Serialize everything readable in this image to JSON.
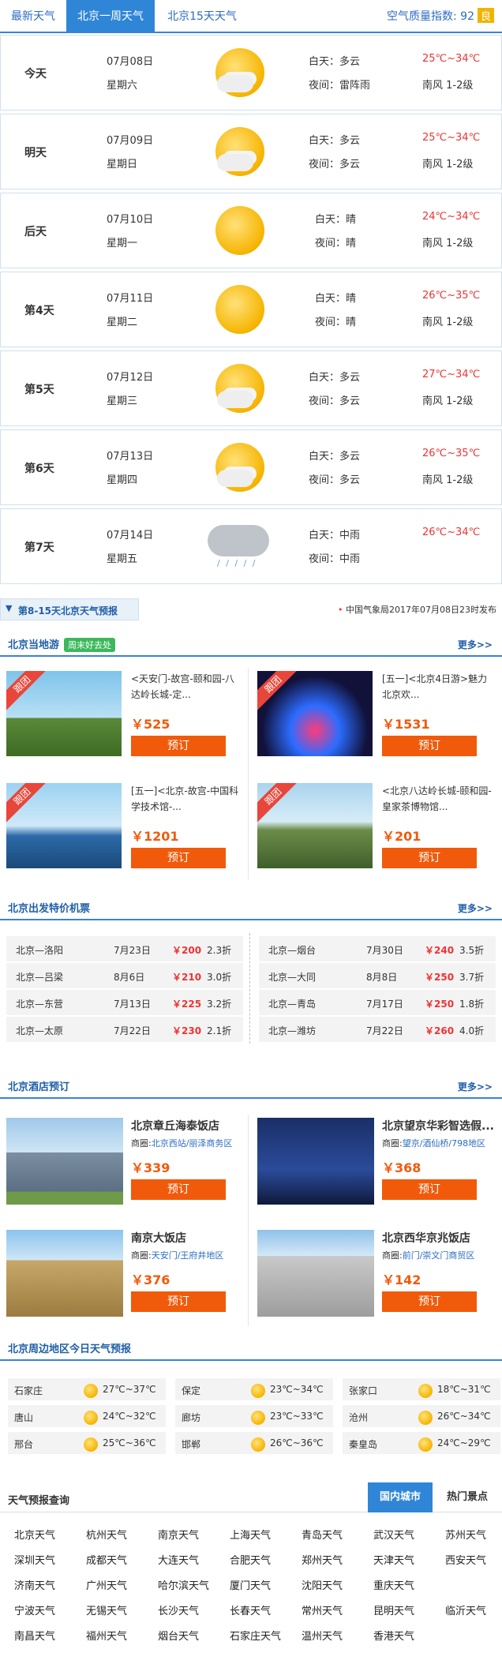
{
  "tabs": {
    "latest": "最新天气",
    "week": "北京一周天气",
    "fifteen": "北京15天天气"
  },
  "aqi": {
    "label": "空气质量指数:",
    "value": "92",
    "level": "良"
  },
  "forecast": [
    {
      "label": "今天",
      "date": "07月08日",
      "weekday": "星期六",
      "icon": "sun-cloud-icon",
      "day": "白天：多云",
      "night": "夜间：雷阵雨",
      "temp": "25℃~34℃",
      "wind": "南风 1-2级"
    },
    {
      "label": "明天",
      "date": "07月09日",
      "weekday": "星期日",
      "icon": "sun-cloud-icon",
      "day": "白天：多云",
      "night": "夜间：多云",
      "temp": "25℃~34℃",
      "wind": "南风 1-2级"
    },
    {
      "label": "后天",
      "date": "07月10日",
      "weekday": "星期一",
      "icon": "sun-icon",
      "day": "白天：晴",
      "night": "夜间：晴",
      "temp": "24℃~34℃",
      "wind": "南风 1-2级"
    },
    {
      "label": "第4天",
      "date": "07月11日",
      "weekday": "星期二",
      "icon": "sun-icon",
      "day": "白天：晴",
      "night": "夜间：晴",
      "temp": "26℃~35℃",
      "wind": "南风 1-2级"
    },
    {
      "label": "第5天",
      "date": "07月12日",
      "weekday": "星期三",
      "icon": "sun-cloud-icon",
      "day": "白天：多云",
      "night": "夜间：多云",
      "temp": "27℃~34℃",
      "wind": "南风 1-2级"
    },
    {
      "label": "第6天",
      "date": "07月13日",
      "weekday": "星期四",
      "icon": "sun-cloud-icon",
      "day": "白天：多云",
      "night": "夜间：多云",
      "temp": "26℃~35℃",
      "wind": "南风 1-2级"
    },
    {
      "label": "第7天",
      "date": "07月14日",
      "weekday": "星期五",
      "icon": "rain-cloud-icon",
      "day": "白天：中雨",
      "night": "夜间：中雨",
      "temp": "26℃~34℃",
      "wind": ""
    }
  ],
  "more15": {
    "label": "第8-15天北京天气预报",
    "source": "中国气象局2017年07月08日23时发布"
  },
  "tour": {
    "title": "北京当地游",
    "tag": "周末好去处",
    "more": "更多>>",
    "ribbon": "跟团",
    "book": "预订",
    "items": [
      {
        "desc": "<天安门-故宫-颐和园-八达岭长城-定...",
        "price": "￥525"
      },
      {
        "desc": "[五一]<北京4日游>魅力北京欢...",
        "price": "￥1531"
      },
      {
        "desc": "[五一]<北京-故宫-中国科学技术馆-...",
        "price": "￥1201"
      },
      {
        "desc": "<北京八达岭长城-颐和园-皇家茶博物馆...",
        "price": "￥201"
      }
    ]
  },
  "flights": {
    "title": "北京出发特价机票",
    "more": "更多>>",
    "left": [
      {
        "route": "北京—洛阳",
        "date": "7月23日",
        "price": "￥200",
        "disc": "2.3折"
      },
      {
        "route": "北京—吕梁",
        "date": "8月6日",
        "price": "￥210",
        "disc": "3.0折"
      },
      {
        "route": "北京—东营",
        "date": "7月13日",
        "price": "￥225",
        "disc": "3.2折"
      },
      {
        "route": "北京—太原",
        "date": "7月22日",
        "price": "￥230",
        "disc": "2.1折"
      }
    ],
    "right": [
      {
        "route": "北京—烟台",
        "date": "7月30日",
        "price": "￥240",
        "disc": "3.5折"
      },
      {
        "route": "北京—大同",
        "date": "8月8日",
        "price": "￥250",
        "disc": "3.7折"
      },
      {
        "route": "北京—青岛",
        "date": "7月17日",
        "price": "￥250",
        "disc": "1.8折"
      },
      {
        "route": "北京—潍坊",
        "date": "7月22日",
        "price": "￥260",
        "disc": "4.0折"
      }
    ]
  },
  "hotels": {
    "title": "北京酒店预订",
    "more": "更多>>",
    "book": "预订",
    "area_label": "商圈:",
    "items": [
      {
        "name": "北京章丘海泰饭店",
        "area": "北京西站/丽泽商务区",
        "price": "￥339"
      },
      {
        "name": "北京望京华彩智选假...",
        "area": "望京/酒仙桥/798地区",
        "price": "￥368"
      },
      {
        "name": "南京大饭店",
        "area": "天安门/王府井地区",
        "price": "￥376"
      },
      {
        "name": "北京西华京兆饭店",
        "area": "前门/崇文门商贸区",
        "price": "￥142"
      }
    ]
  },
  "nearby": {
    "title": "北京周边地区今日天气预报",
    "cols": [
      [
        {
          "city": "石家庄",
          "temp": "27℃~37℃"
        },
        {
          "city": "唐山",
          "temp": "24℃~32℃"
        },
        {
          "city": "邢台",
          "temp": "25℃~36℃"
        }
      ],
      [
        {
          "city": "保定",
          "temp": "23℃~34℃"
        },
        {
          "city": "廊坊",
          "temp": "23℃~33℃"
        },
        {
          "city": "邯郸",
          "temp": "26℃~36℃"
        }
      ],
      [
        {
          "city": "张家口",
          "temp": "18℃~31℃"
        },
        {
          "city": "沧州",
          "temp": "26℃~34℃"
        },
        {
          "city": "秦皇岛",
          "temp": "24℃~29℃"
        }
      ]
    ]
  },
  "query": {
    "title": "天气预报查询",
    "tab_domestic": "国内城市",
    "tab_scenic": "热门景点",
    "cities": [
      [
        "北京天气",
        "杭州天气",
        "南京天气",
        "上海天气",
        "青岛天气",
        "武汉天气",
        "苏州天气"
      ],
      [
        "深圳天气",
        "成都天气",
        "大连天气",
        "合肥天气",
        "郑州天气",
        "天津天气",
        "西安天气"
      ],
      [
        "济南天气",
        "广州天气",
        "哈尔滨天气",
        "厦门天气",
        "沈阳天气",
        "重庆天气"
      ],
      [
        "宁波天气",
        "无锡天气",
        "长沙天气",
        "长春天气",
        "常州天气",
        "昆明天气",
        "临沂天气"
      ],
      [
        "南昌天气",
        "福州天气",
        "烟台天气",
        "石家庄天气",
        "温州天气",
        "香港天气"
      ]
    ]
  }
}
